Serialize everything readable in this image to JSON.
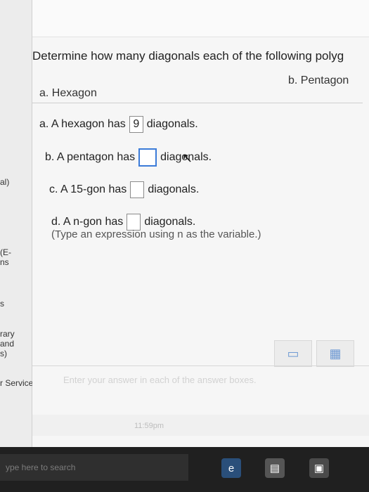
{
  "sidebar": {
    "items": [
      {
        "text": "al)"
      },
      {
        "text": "(E-"
      },
      {
        "text": "ns"
      },
      {
        "text": "s"
      },
      {
        "text": "rary"
      },
      {
        "text": "and"
      },
      {
        "text": "s)"
      },
      {
        "text": "r Services"
      }
    ]
  },
  "question": {
    "title": "Determine how many diagonals each of the following polyg",
    "part_a_label": "a. Hexagon",
    "part_b_label": "b. Pentagon",
    "items": [
      {
        "before": "a. A hexagon has",
        "value": "9",
        "after": "diagonals."
      },
      {
        "before": "b. A pentagon has",
        "value": "",
        "after": "diagonals."
      },
      {
        "before": "c. A 15-gon has",
        "value": "",
        "after": "diagonals."
      },
      {
        "before": "d. A n-gon has",
        "value": "",
        "after": "diagonals."
      }
    ],
    "hint": "(Type an expression using n as the variable.)"
  },
  "footer": {
    "enter_text": "Enter your answer in each of the answer boxes.",
    "time_text": "11:59pm"
  },
  "taskbar": {
    "search_placeholder": "ype here to search"
  }
}
